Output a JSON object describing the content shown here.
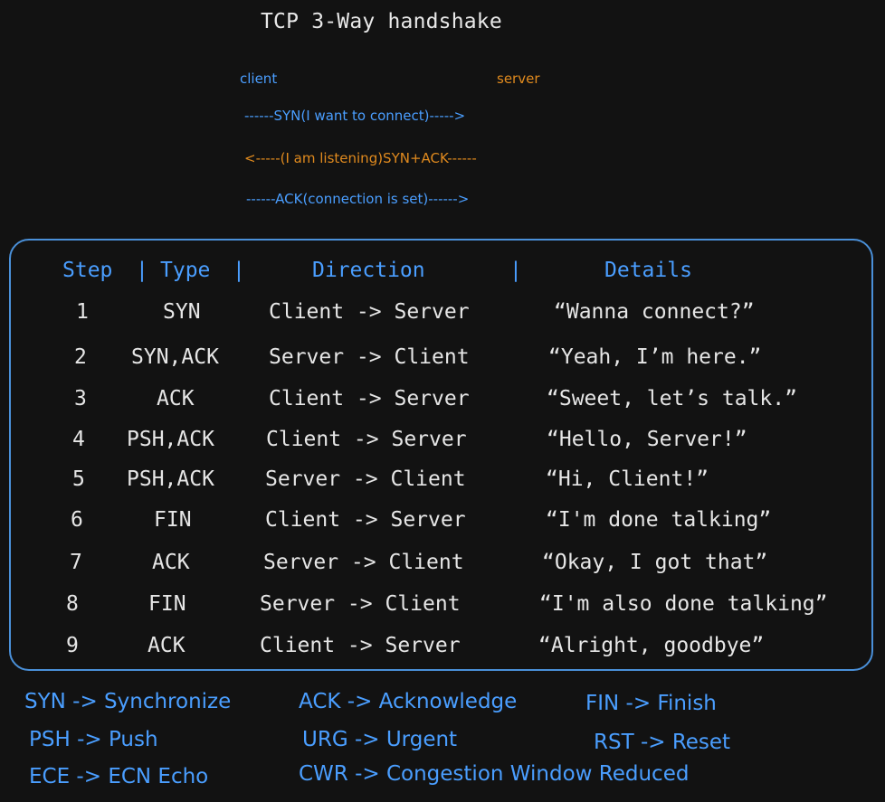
{
  "title": "TCP 3-Way handshake",
  "handshake": {
    "client_label": "client",
    "server_label": "server",
    "arrows": [
      "------SYN(I want to connect)----->",
      "<-----(I am listening)SYN+ACK------",
      "------ACK(connection is set)------>"
    ]
  },
  "table": {
    "headers": [
      "Step",
      "|",
      "Type",
      "|",
      "Direction",
      "|",
      "Details"
    ],
    "rows": [
      {
        "step": "1",
        "type": "SYN",
        "direction": "Client -> Server",
        "details": "“Wanna connect?”"
      },
      {
        "step": "2",
        "type": "SYN,ACK",
        "direction": "Server -> Client",
        "details": "“Yeah, I’m here.”"
      },
      {
        "step": "3",
        "type": "ACK",
        "direction": "Client -> Server",
        "details": "“Sweet, let’s talk.”"
      },
      {
        "step": "4",
        "type": "PSH,ACK",
        "direction": "Client -> Server",
        "details": "“Hello, Server!”"
      },
      {
        "step": "5",
        "type": "PSH,ACK",
        "direction": "Server -> Client",
        "details": "“Hi, Client!”"
      },
      {
        "step": "6",
        "type": "FIN",
        "direction": "Client -> Server",
        "details": "“I'm done talking”"
      },
      {
        "step": "7",
        "type": "ACK",
        "direction": "Server -> Client",
        "details": "“Okay, I got that”"
      },
      {
        "step": "8",
        "type": "FIN",
        "direction": "Server -> Client",
        "details": "“I'm also done talking”"
      },
      {
        "step": "9",
        "type": "ACK",
        "direction": "Client -> Server",
        "details": "“Alright, goodbye”"
      }
    ]
  },
  "legend": {
    "syn": "SYN -> Synchronize",
    "ack": "ACK -> Acknowledge",
    "fin": "FIN -> Finish",
    "psh": "PSH -> Push",
    "urg": "URG -> Urgent",
    "rst": "RST -> Reset",
    "ece": "ECE -> ECN Echo",
    "cwr": "CWR -> Congestion Window Reduced"
  },
  "colors": {
    "background": "#121212",
    "blue": "#4a9eff",
    "orange": "#e08a1e",
    "border": "#4a90d9",
    "text": "#e6e6e6"
  }
}
